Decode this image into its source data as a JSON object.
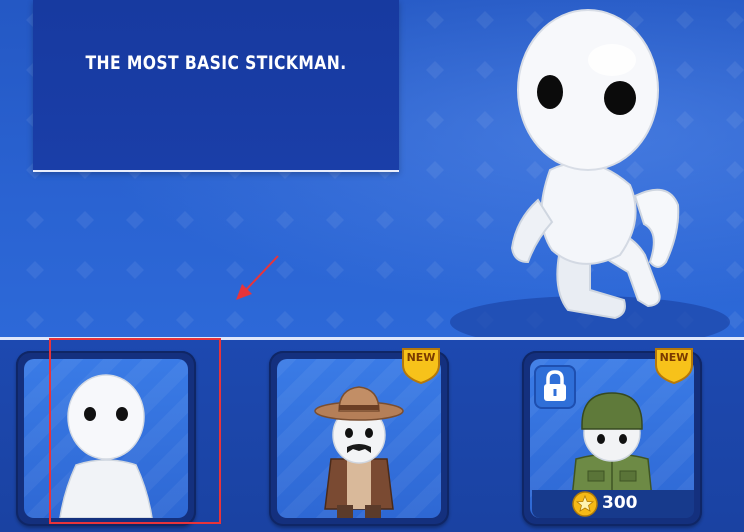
{
  "description": "THE MOST BASIC STICKMAN.",
  "shop": {
    "items": [
      {
        "character": "basic-stickman",
        "badge": "",
        "locked": false,
        "selected": true
      },
      {
        "character": "cowboy",
        "badge": "NEW",
        "locked": false,
        "selected": false
      },
      {
        "character": "soldier",
        "badge": "NEW",
        "locked": true,
        "price": "300",
        "currency_icon": "star-coin-icon",
        "selected": false
      }
    ]
  },
  "colors": {
    "background": "#2a63d2",
    "card_frame": "#14307e",
    "badge": "#f7c21a",
    "selection": "#e8343a",
    "pointer_arrow": "#e8343a"
  }
}
